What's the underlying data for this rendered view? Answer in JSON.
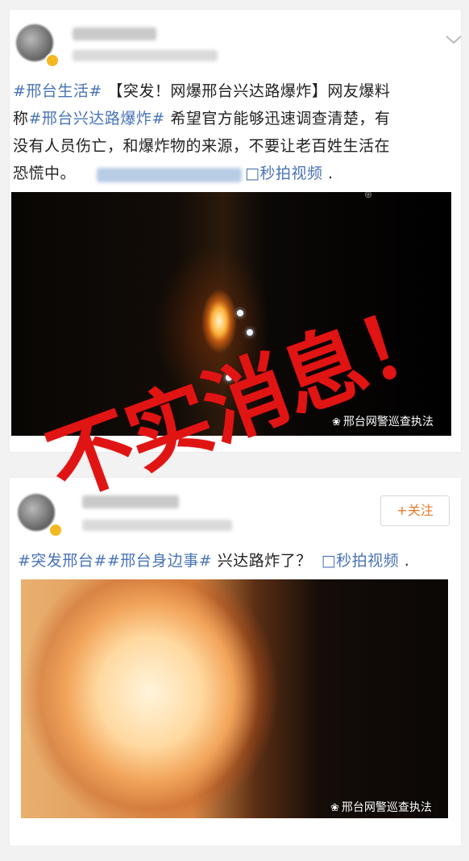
{
  "post1": {
    "hashtag1": "#邢台生活#",
    "body_part1": " 【突发！网爆邢台兴达路爆炸】网友爆料",
    "body_part2_prefix": "称",
    "hashtag2": "#邢台兴达路爆炸#",
    "body_part2_suffix": " 希望官方能够迅速调查清楚，有",
    "body_line3": "没有人员伤亡，和爆炸物的来源，不要让老百姓生活在",
    "body_line4": "恐慌中。",
    "video_link": "□秒拍视频",
    "trailing": " .",
    "watermark": "邢台网警巡查执法",
    "video_top_mark": "⊕"
  },
  "post2": {
    "follow_label": "+关注",
    "hashtag1": "#突发邢台#",
    "hashtag2": "#邢台身边事#",
    "body": " 兴达路炸了？",
    "video_link": "□秒拍视频",
    "trailing": " .",
    "watermark": "邢台网警巡查执法"
  },
  "stamp_text": "不实消息！",
  "colors": {
    "link": "#4873b7",
    "stamp": "#e11414",
    "follow": "#e8782b",
    "badge": "#f6b822"
  },
  "icons": {
    "chevron": "chevron-down-icon",
    "video": "video-camera-icon",
    "watermark": "wechat-logo-icon"
  }
}
